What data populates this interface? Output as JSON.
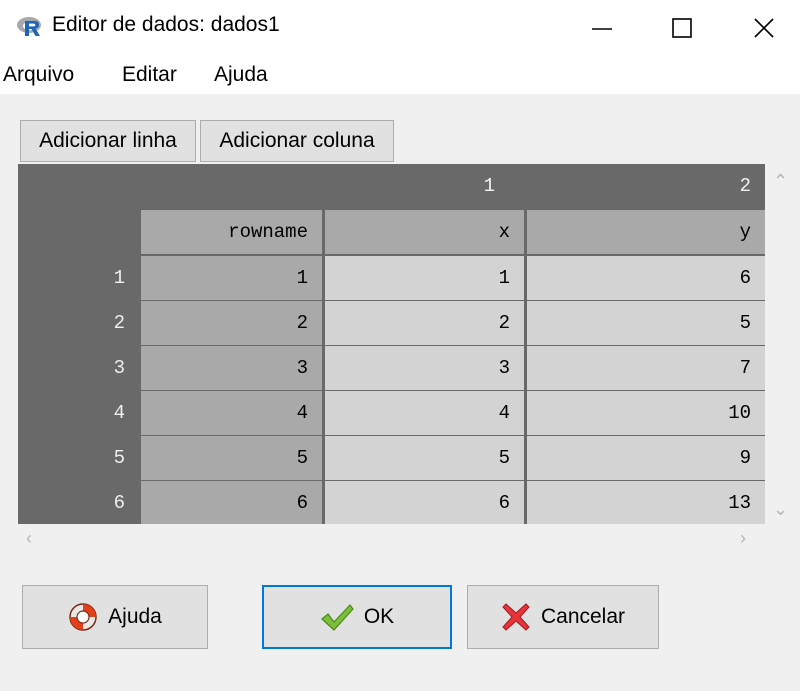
{
  "window": {
    "title": "Editor de dados: dados1",
    "icon": "r-logo-icon",
    "controls": [
      "minimize-icon",
      "maximize-icon",
      "close-icon"
    ]
  },
  "menu": {
    "items": [
      "Arquivo",
      "Editar",
      "Ajuda"
    ]
  },
  "toolbar": {
    "add_row_label": "Adicionar linha",
    "add_column_label": "Adicionar coluna"
  },
  "grid": {
    "column_numbers": [
      "1",
      "2"
    ],
    "headers": [
      "rowname",
      "x",
      "y"
    ],
    "row_numbers": [
      "1",
      "2",
      "3",
      "4",
      "5",
      "6"
    ],
    "rows": [
      [
        "1",
        "1",
        "6"
      ],
      [
        "2",
        "2",
        "5"
      ],
      [
        "3",
        "3",
        "7"
      ],
      [
        "4",
        "4",
        "10"
      ],
      [
        "5",
        "5",
        "9"
      ],
      [
        "6",
        "6",
        "13"
      ]
    ]
  },
  "buttons": {
    "help_label": "Ajuda",
    "ok_label": "OK",
    "cancel_label": "Cancelar"
  },
  "colors": {
    "grid_background": "#696969",
    "header_cell": "#a9a9a9",
    "data_cell": "#d3d3d3",
    "focus_border": "#0078d7"
  }
}
